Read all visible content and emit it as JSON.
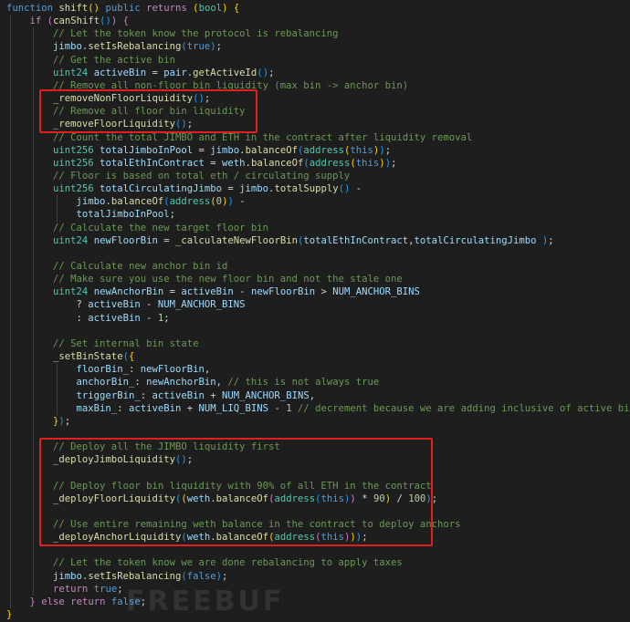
{
  "editor": {
    "theme": "dark",
    "background": "#1e1e1e",
    "highlight_color": "#e0201c",
    "lines": [
      [
        [
          "kw",
          "function "
        ],
        [
          "fn",
          "shift"
        ],
        [
          "br1",
          "()"
        ],
        [
          "pn",
          " "
        ],
        [
          "kw",
          "public"
        ],
        [
          "pn",
          " "
        ],
        [
          "ctl",
          "returns"
        ],
        [
          "pn",
          " "
        ],
        [
          "br1",
          "("
        ],
        [
          "ty",
          "bool"
        ],
        [
          "br1",
          ")"
        ],
        [
          "pn",
          " "
        ],
        [
          "br1",
          "{"
        ]
      ],
      [
        [
          "pn",
          "    "
        ],
        [
          "ctl",
          "if"
        ],
        [
          "pn",
          " "
        ],
        [
          "br2",
          "("
        ],
        [
          "fn",
          "canShift"
        ],
        [
          "br3",
          "()"
        ],
        [
          "br2",
          ")"
        ],
        [
          "pn",
          " "
        ],
        [
          "br2",
          "{"
        ]
      ],
      [
        [
          "pn",
          "        "
        ],
        [
          "cm",
          "// Let the token know the protocol is rebalancing"
        ]
      ],
      [
        [
          "pn",
          "        "
        ],
        [
          "var",
          "jimbo"
        ],
        [
          "pn",
          "."
        ],
        [
          "fn",
          "setIsRebalancing"
        ],
        [
          "br3",
          "("
        ],
        [
          "kw",
          "true"
        ],
        [
          "br3",
          ")"
        ],
        [
          "pn",
          ";"
        ]
      ],
      [
        [
          "pn",
          "        "
        ],
        [
          "cm",
          "// Get the active bin"
        ]
      ],
      [
        [
          "pn",
          "        "
        ],
        [
          "ty",
          "uint24"
        ],
        [
          "pn",
          " "
        ],
        [
          "var",
          "activeBin"
        ],
        [
          "pn",
          " = "
        ],
        [
          "var",
          "pair"
        ],
        [
          "pn",
          "."
        ],
        [
          "fn",
          "getActiveId"
        ],
        [
          "br3",
          "()"
        ],
        [
          "pn",
          ";"
        ]
      ],
      [
        [
          "pn",
          "        "
        ],
        [
          "cm",
          "// Remove all non-floor bin liquidity (max bin -> anchor bin)"
        ]
      ],
      [
        [
          "pn",
          "        "
        ],
        [
          "fn",
          "_removeNonFloorLiquidity"
        ],
        [
          "br3",
          "()"
        ],
        [
          "pn",
          ";"
        ]
      ],
      [
        [
          "pn",
          "        "
        ],
        [
          "cm",
          "// Remove all floor bin liquidity"
        ]
      ],
      [
        [
          "pn",
          "        "
        ],
        [
          "fn",
          "_removeFloorLiquidity"
        ],
        [
          "br3",
          "()"
        ],
        [
          "pn",
          ";"
        ]
      ],
      [
        [
          "pn",
          "        "
        ],
        [
          "cm",
          "// Count the total JIMBO and ETH in the contract after liquidity removal"
        ]
      ],
      [
        [
          "pn",
          "        "
        ],
        [
          "ty",
          "uint256"
        ],
        [
          "pn",
          " "
        ],
        [
          "var",
          "totalJimboInPool"
        ],
        [
          "pn",
          " = "
        ],
        [
          "var",
          "jimbo"
        ],
        [
          "pn",
          "."
        ],
        [
          "fn",
          "balanceOf"
        ],
        [
          "br3",
          "("
        ],
        [
          "ty",
          "address"
        ],
        [
          "br1",
          "("
        ],
        [
          "kw",
          "this"
        ],
        [
          "br1",
          ")"
        ],
        [
          "br3",
          ")"
        ],
        [
          "pn",
          ";"
        ]
      ],
      [
        [
          "pn",
          "        "
        ],
        [
          "ty",
          "uint256"
        ],
        [
          "pn",
          " "
        ],
        [
          "var",
          "totalEthInContract"
        ],
        [
          "pn",
          " = "
        ],
        [
          "var",
          "weth"
        ],
        [
          "pn",
          "."
        ],
        [
          "fn",
          "balanceOf"
        ],
        [
          "br3",
          "("
        ],
        [
          "ty",
          "address"
        ],
        [
          "br1",
          "("
        ],
        [
          "kw",
          "this"
        ],
        [
          "br1",
          ")"
        ],
        [
          "br3",
          ")"
        ],
        [
          "pn",
          ";"
        ]
      ],
      [
        [
          "pn",
          "        "
        ],
        [
          "cm",
          "// Floor is based on total eth / circulating supply"
        ]
      ],
      [
        [
          "pn",
          "        "
        ],
        [
          "ty",
          "uint256"
        ],
        [
          "pn",
          " "
        ],
        [
          "var",
          "totalCirculatingJimbo"
        ],
        [
          "pn",
          " = "
        ],
        [
          "var",
          "jimbo"
        ],
        [
          "pn",
          "."
        ],
        [
          "fn",
          "totalSupply"
        ],
        [
          "br3",
          "()"
        ],
        [
          "pn",
          " -"
        ]
      ],
      [
        [
          "pn",
          "            "
        ],
        [
          "var",
          "jimbo"
        ],
        [
          "pn",
          "."
        ],
        [
          "fn",
          "balanceOf"
        ],
        [
          "br3",
          "("
        ],
        [
          "ty",
          "address"
        ],
        [
          "br1",
          "("
        ],
        [
          "num",
          "0"
        ],
        [
          "br1",
          ")"
        ],
        [
          "br3",
          ")"
        ],
        [
          "pn",
          " -"
        ]
      ],
      [
        [
          "pn",
          "            "
        ],
        [
          "var",
          "totalJimboInPool"
        ],
        [
          "pn",
          ";"
        ]
      ],
      [
        [
          "pn",
          "        "
        ],
        [
          "cm",
          "// Calculate the new target floor bin"
        ]
      ],
      [
        [
          "pn",
          "        "
        ],
        [
          "ty",
          "uint24"
        ],
        [
          "pn",
          " "
        ],
        [
          "var",
          "newFloorBin"
        ],
        [
          "pn",
          " = "
        ],
        [
          "fn",
          "_calculateNewFloorBin"
        ],
        [
          "br3",
          "("
        ],
        [
          "var",
          "totalEthInContract"
        ],
        [
          "pn",
          ","
        ],
        [
          "var",
          "totalCirculatingJimbo"
        ],
        [
          "pn",
          " "
        ],
        [
          "br3",
          ")"
        ],
        [
          "pn",
          ";"
        ]
      ],
      [],
      [
        [
          "pn",
          "        "
        ],
        [
          "cm",
          "// Calculate new anchor bin id"
        ]
      ],
      [
        [
          "pn",
          "        "
        ],
        [
          "cm",
          "// Make sure you use the new floor bin and not the stale one"
        ]
      ],
      [
        [
          "pn",
          "        "
        ],
        [
          "ty",
          "uint24"
        ],
        [
          "pn",
          " "
        ],
        [
          "var",
          "newAnchorBin"
        ],
        [
          "pn",
          " = "
        ],
        [
          "var",
          "activeBin"
        ],
        [
          "pn",
          " - "
        ],
        [
          "var",
          "newFloorBin"
        ],
        [
          "pn",
          " > "
        ],
        [
          "var",
          "NUM_ANCHOR_BINS"
        ]
      ],
      [
        [
          "pn",
          "            ? "
        ],
        [
          "var",
          "activeBin"
        ],
        [
          "pn",
          " - "
        ],
        [
          "var",
          "NUM_ANCHOR_BINS"
        ]
      ],
      [
        [
          "pn",
          "            : "
        ],
        [
          "var",
          "activeBin"
        ],
        [
          "pn",
          " - "
        ],
        [
          "num",
          "1"
        ],
        [
          "pn",
          ";"
        ]
      ],
      [],
      [
        [
          "pn",
          "        "
        ],
        [
          "cm",
          "// Set internal bin state"
        ]
      ],
      [
        [
          "pn",
          "        "
        ],
        [
          "fn",
          "_setBinState"
        ],
        [
          "br3",
          "("
        ],
        [
          "br1",
          "{"
        ]
      ],
      [
        [
          "pn",
          "            "
        ],
        [
          "var",
          "floorBin_"
        ],
        [
          "pn",
          ": "
        ],
        [
          "var",
          "newFloorBin"
        ],
        [
          "pn",
          ","
        ]
      ],
      [
        [
          "pn",
          "            "
        ],
        [
          "var",
          "anchorBin_"
        ],
        [
          "pn",
          ": "
        ],
        [
          "var",
          "newAnchorBin"
        ],
        [
          "pn",
          ", "
        ],
        [
          "cm",
          "// this is not always true"
        ]
      ],
      [
        [
          "pn",
          "            "
        ],
        [
          "var",
          "triggerBin_"
        ],
        [
          "pn",
          ": "
        ],
        [
          "var",
          "activeBin"
        ],
        [
          "pn",
          " + "
        ],
        [
          "var",
          "NUM_ANCHOR_BINS"
        ],
        [
          "pn",
          ","
        ]
      ],
      [
        [
          "pn",
          "            "
        ],
        [
          "var",
          "maxBin_"
        ],
        [
          "pn",
          ": "
        ],
        [
          "var",
          "activeBin"
        ],
        [
          "pn",
          " + "
        ],
        [
          "var",
          "NUM_LIQ_BINS"
        ],
        [
          "pn",
          " - "
        ],
        [
          "num",
          "1"
        ],
        [
          "pn",
          " "
        ],
        [
          "cm",
          "// decrement because we are adding inclusive of active bin"
        ]
      ],
      [
        [
          "pn",
          "        "
        ],
        [
          "br1",
          "}"
        ],
        [
          "br3",
          ")"
        ],
        [
          "pn",
          ";"
        ]
      ],
      [],
      [
        [
          "pn",
          "        "
        ],
        [
          "cm",
          "// Deploy all the JIMBO liquidity first"
        ]
      ],
      [
        [
          "pn",
          "        "
        ],
        [
          "fn",
          "_deployJimboLiquidity"
        ],
        [
          "br3",
          "()"
        ],
        [
          "pn",
          ";"
        ]
      ],
      [],
      [
        [
          "pn",
          "        "
        ],
        [
          "cm",
          "// Deploy floor bin liquidity with 90% of all ETH in the contract"
        ]
      ],
      [
        [
          "pn",
          "        "
        ],
        [
          "fn",
          "_deployFloorLiquidity"
        ],
        [
          "br3",
          "("
        ],
        [
          "br1",
          "("
        ],
        [
          "var",
          "weth"
        ],
        [
          "pn",
          "."
        ],
        [
          "fn",
          "balanceOf"
        ],
        [
          "br2",
          "("
        ],
        [
          "ty",
          "address"
        ],
        [
          "br3",
          "("
        ],
        [
          "kw",
          "this"
        ],
        [
          "br3",
          ")"
        ],
        [
          "br2",
          ")"
        ],
        [
          "pn",
          " * "
        ],
        [
          "num",
          "90"
        ],
        [
          "br1",
          ")"
        ],
        [
          "pn",
          " / "
        ],
        [
          "num",
          "100"
        ],
        [
          "br3",
          ")"
        ],
        [
          "pn",
          ";"
        ]
      ],
      [],
      [
        [
          "pn",
          "        "
        ],
        [
          "cm",
          "// Use entire remaining weth balance in the contract to deploy anchors"
        ]
      ],
      [
        [
          "pn",
          "        "
        ],
        [
          "fn",
          "_deployAnchorLiquidity"
        ],
        [
          "br3",
          "("
        ],
        [
          "var",
          "weth"
        ],
        [
          "pn",
          "."
        ],
        [
          "fn",
          "balanceOf"
        ],
        [
          "br1",
          "("
        ],
        [
          "ty",
          "address"
        ],
        [
          "br2",
          "("
        ],
        [
          "kw",
          "this"
        ],
        [
          "br2",
          ")"
        ],
        [
          "br1",
          ")"
        ],
        [
          "br3",
          ")"
        ],
        [
          "pn",
          ";"
        ]
      ],
      [],
      [
        [
          "pn",
          "        "
        ],
        [
          "cm",
          "// Let the token know we are done rebalancing to apply taxes"
        ]
      ],
      [
        [
          "pn",
          "        "
        ],
        [
          "var",
          "jimbo"
        ],
        [
          "pn",
          "."
        ],
        [
          "fn",
          "setIsRebalancing"
        ],
        [
          "br3",
          "("
        ],
        [
          "kw",
          "false"
        ],
        [
          "br3",
          ")"
        ],
        [
          "pn",
          ";"
        ]
      ],
      [
        [
          "pn",
          "        "
        ],
        [
          "ctl",
          "return"
        ],
        [
          "pn",
          " "
        ],
        [
          "kw",
          "true"
        ],
        [
          "pn",
          ";"
        ]
      ],
      [
        [
          "pn",
          "    "
        ],
        [
          "br2",
          "}"
        ],
        [
          "pn",
          " "
        ],
        [
          "ctl",
          "else"
        ],
        [
          "pn",
          " "
        ],
        [
          "ctl",
          "return"
        ],
        [
          "pn",
          " "
        ],
        [
          "kw",
          "false"
        ],
        [
          "pn",
          ";"
        ]
      ],
      [
        [
          "br1",
          "}"
        ]
      ]
    ],
    "highlight_boxes": [
      {
        "name": "highlight-remove-liquidity",
        "from_line": 7,
        "to_line": 9
      },
      {
        "name": "highlight-deploy-liquidity",
        "from_line": 34,
        "to_line": 41
      }
    ],
    "watermark": "FREEBUF"
  }
}
